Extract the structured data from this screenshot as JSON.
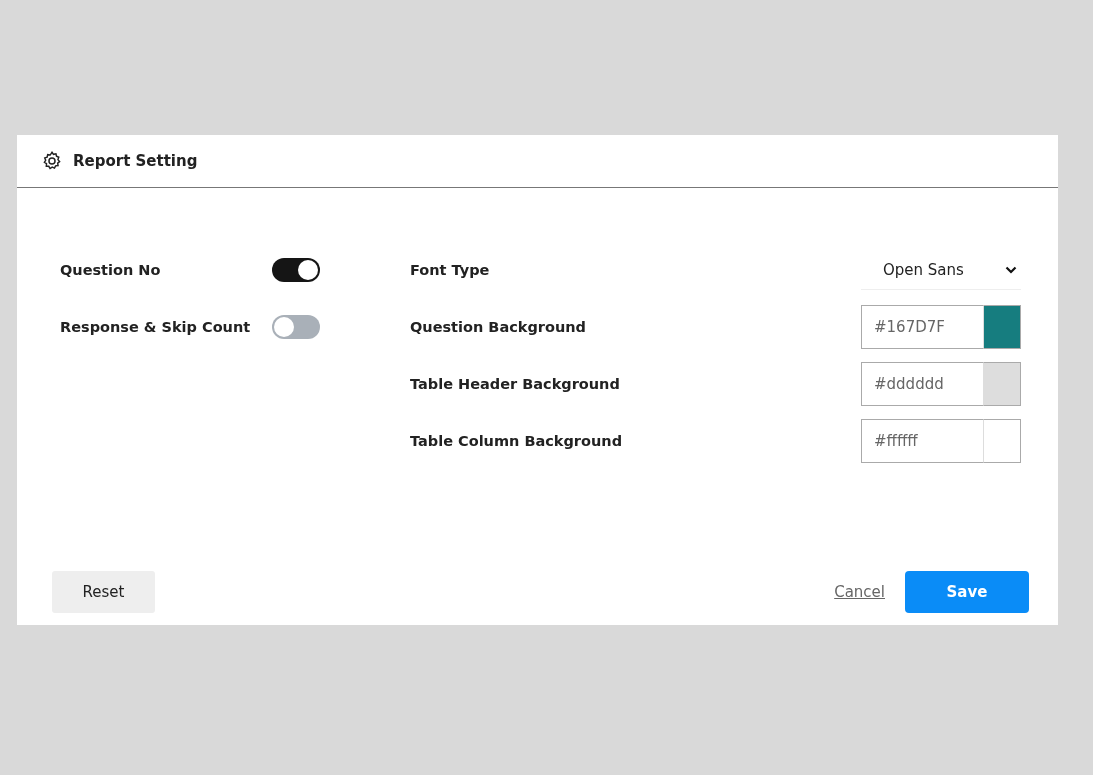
{
  "dialog": {
    "title": "Report Setting"
  },
  "toggles": [
    {
      "label": "Question No",
      "on": true
    },
    {
      "label": "Response & Skip Count",
      "on": false
    }
  ],
  "font_type": {
    "label": "Font Type",
    "value": "Open Sans"
  },
  "color_settings": [
    {
      "label": "Question Background",
      "value": "#167D7F",
      "color": "#167d7f"
    },
    {
      "label": "Table Header Background",
      "value": "#dddddd",
      "color": "#dddddd"
    },
    {
      "label": "Table Column Background",
      "value": "#ffffff",
      "color": "#ffffff"
    }
  ],
  "footer": {
    "reset": "Reset",
    "cancel": "Cancel",
    "save": "Save"
  }
}
